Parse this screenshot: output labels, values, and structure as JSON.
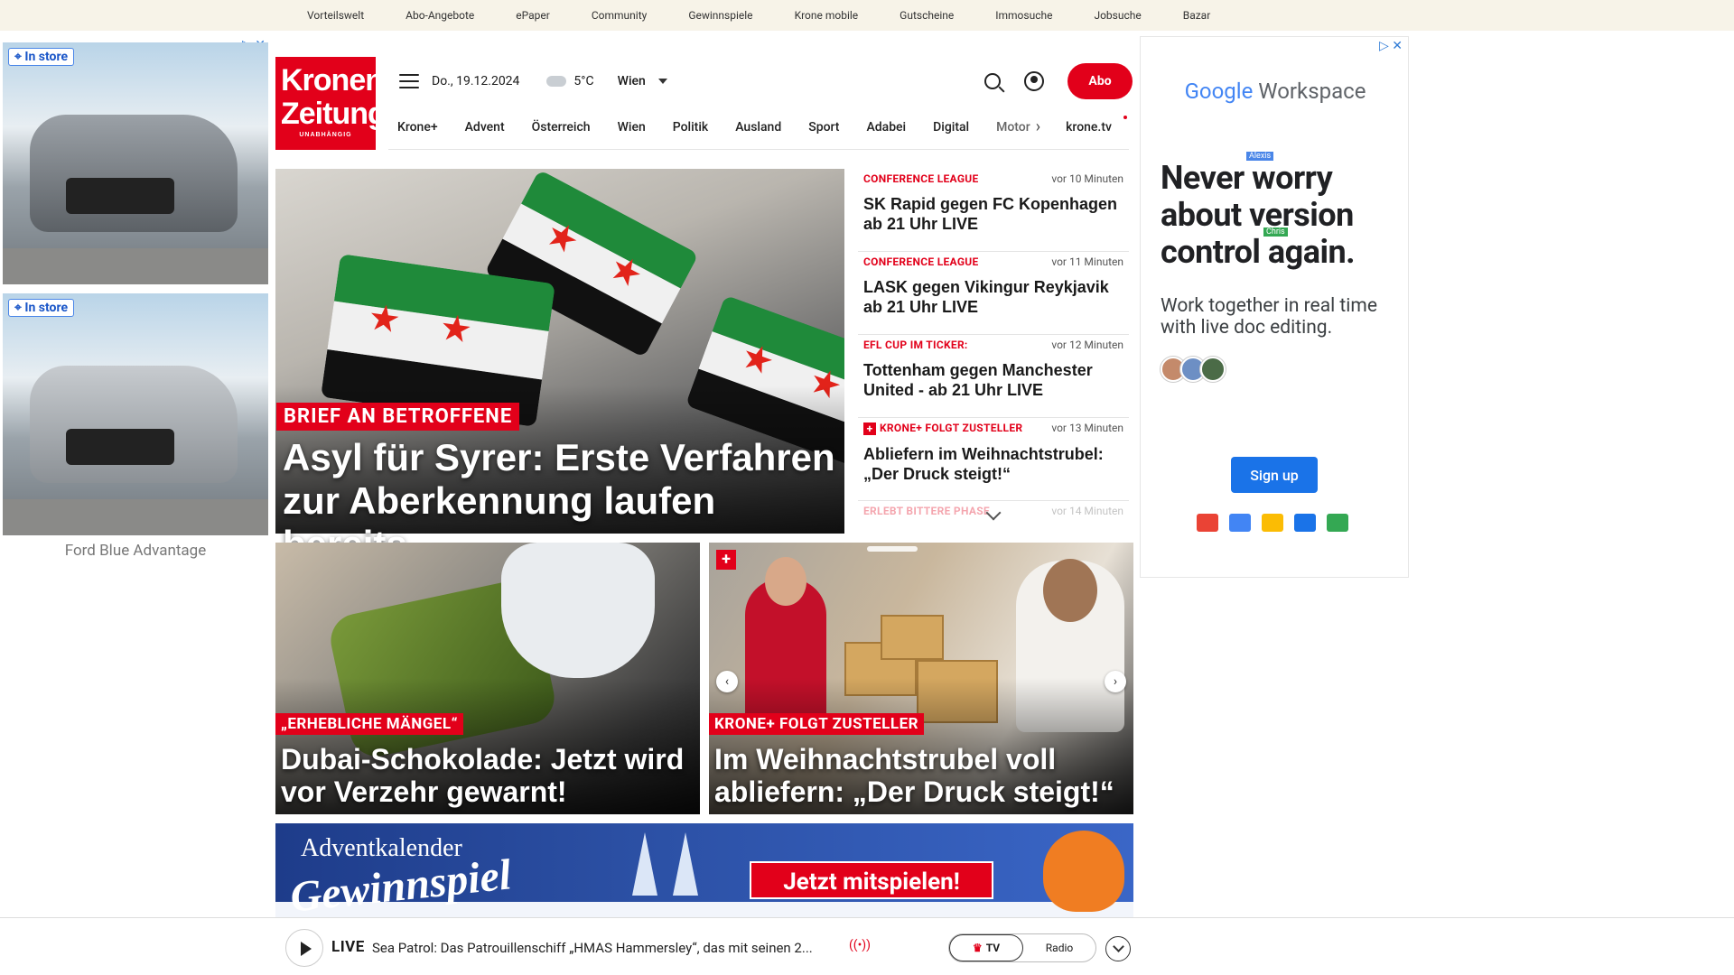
{
  "topbar": [
    "Vorteilswelt",
    "Abo-Angebote",
    "ePaper",
    "Community",
    "Gewinnspiele",
    "Krone mobile",
    "Gutscheine",
    "Immosuche",
    "Jobsuche",
    "Bazar"
  ],
  "left_ad": {
    "badge": "In store",
    "choices": "▷ ✕",
    "caption": "Ford Blue Advantage"
  },
  "logo": {
    "line1": "Kronen",
    "line2": "Zeitung",
    "tagline": "UNABHÄNGIG"
  },
  "header": {
    "date": "Do., 19.12.2024",
    "temperature": "5°C",
    "city": "Wien",
    "abo": "Abo"
  },
  "nav": [
    "Krone+",
    "Advent",
    "Österreich",
    "Wien",
    "Politik",
    "Ausland",
    "Sport",
    "Adabei",
    "Digital",
    "Motor"
  ],
  "nav_extra": "krone.tv",
  "hero": {
    "kicker": "BRIEF AN BETROFFENE",
    "title": "Asyl für Syrer: Erste Verfahren zur Aberkennung laufen bereits"
  },
  "ticker": [
    {
      "kicker": "CONFERENCE LEAGUE",
      "time": "vor 10 Minuten",
      "title": "SK Rapid gegen FC Kopenhagen ab 21 Uhr LIVE",
      "plus": false
    },
    {
      "kicker": "CONFERENCE LEAGUE",
      "time": "vor 11 Minuten",
      "title": "LASK gegen Vikingur Reykjavik ab 21 Uhr LIVE",
      "plus": false
    },
    {
      "kicker": "EFL CUP IM TICKER:",
      "time": "vor 12 Minuten",
      "title": "Tottenham gegen Manchester United - ab 21 Uhr LIVE",
      "plus": false
    },
    {
      "kicker": "KRONE+ FOLGT ZUSTELLER",
      "time": "vor 13 Minuten",
      "title": "Abliefern im Weihnachtstrubel: „Der Druck steigt!“",
      "plus": true
    },
    {
      "kicker": "ERLEBT BITTERE PHASE",
      "time": "vor 14 Minuten",
      "title": "",
      "plus": false
    }
  ],
  "cards": [
    {
      "kicker": "„ERHEBLICHE MÄNGEL“",
      "title": "Dubai-Schokolade: Jetzt wird vor Verzehr gewarnt!"
    },
    {
      "kicker": "KRONE+ FOLGT ZUSTELLER",
      "title": "Im Weihnachtstrubel voll abliefern: „Der Druck steigt!“"
    }
  ],
  "advent": {
    "line1": "Adventkalender",
    "line2": "Gewinnspiel",
    "cta": "Jetzt mitspielen!"
  },
  "right_ad": {
    "logo_google": "Google",
    "logo_product": "Workspace",
    "headline": "Never worry about version control again.",
    "sub": "Work together in real time with live doc editing.",
    "cursor1": "Alexis",
    "cursor2": "Chris",
    "cta": "Sign up"
  },
  "player": {
    "live": "LIVE",
    "text": "Sea Patrol: Das Patrouillenschiff „HMAS Hammersley“, das mit seinen 2...",
    "tv": "TV",
    "radio": "Radio"
  },
  "colors": {
    "brand": "#e2001a",
    "topbar_bg": "#f7f3e8",
    "google_blue": "#1a73e8"
  }
}
